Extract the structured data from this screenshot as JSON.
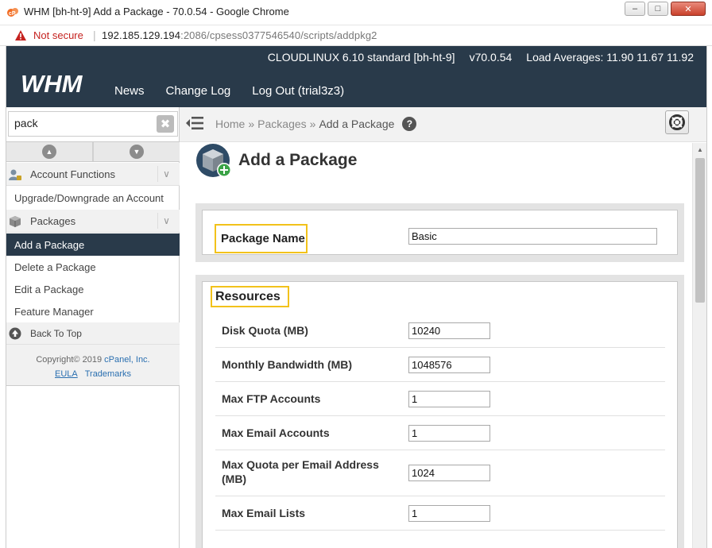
{
  "window": {
    "title": "WHM [bh-ht-9] Add a Package - 70.0.54 - Google Chrome",
    "minimize": "–",
    "maximize": "□",
    "close": "✕"
  },
  "addressbar": {
    "security_label": "Not secure",
    "url_host": "192.185.129.194",
    "url_path": ":2086/cpsess0377546540/scripts/addpkg2"
  },
  "header": {
    "logo_text": "WHM",
    "nav": [
      "News",
      "Change Log",
      "Log Out (trial3z3)"
    ],
    "os": "CLOUDLINUX 6.10 standard [bh-ht-9]",
    "version": "v70.0.54",
    "load": "Load Averages: 11.90 11.67 11.92"
  },
  "sidebar": {
    "search_value": "pack",
    "categories": {
      "account_functions": "Account Functions",
      "packages": "Packages"
    },
    "links": {
      "upgrade": "Upgrade/Downgrade an Account",
      "add": "Add a Package",
      "delete": "Delete a Package",
      "edit": "Edit a Package",
      "feature": "Feature Manager"
    },
    "back_to_top": "Back To Top",
    "copyright_prefix": "Copyright© 2019",
    "copyright_company": "cPanel, Inc.",
    "eula": "EULA",
    "trademarks": "Trademarks"
  },
  "breadcrumb": {
    "home": "Home",
    "packages": "Packages",
    "current": "Add a Package",
    "separator": "»"
  },
  "page": {
    "title": "Add a Package",
    "package_name_label": "Package Name",
    "package_name_value": "Basic",
    "resources_heading": "Resources",
    "resources": [
      {
        "label": "Disk Quota (MB)",
        "value": "10240"
      },
      {
        "label": "Monthly Bandwidth (MB)",
        "value": "1048576"
      },
      {
        "label": "Max FTP Accounts",
        "value": "1"
      },
      {
        "label": "Max Email Accounts",
        "value": "1"
      },
      {
        "label": "Max Quota per Email Address (MB)",
        "value": "1024"
      },
      {
        "label": "Max Email Lists",
        "value": "1"
      }
    ]
  },
  "colors": {
    "header_bg": "#293a4a",
    "highlight": "#f2c21b",
    "not_secure": "#c5221f"
  }
}
